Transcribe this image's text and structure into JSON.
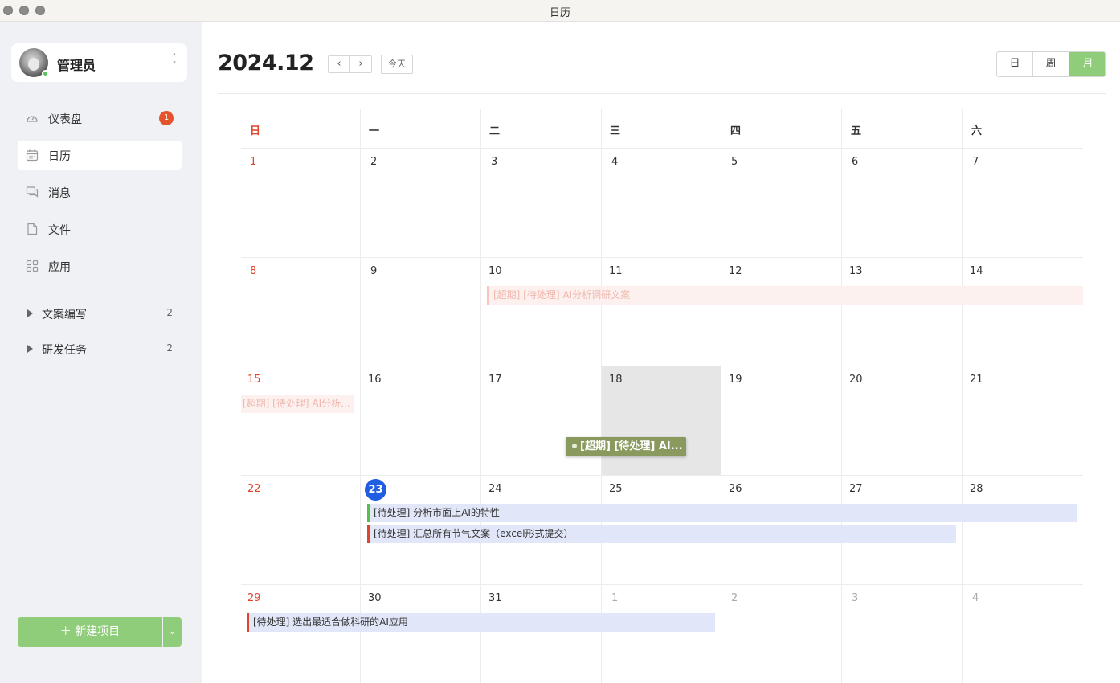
{
  "window": {
    "title": "日历"
  },
  "user": {
    "name": "管理员"
  },
  "nav": {
    "items": [
      {
        "label": "仪表盘",
        "badge": "1",
        "icon": "dashboard-icon"
      },
      {
        "label": "日历",
        "icon": "calendar-icon"
      },
      {
        "label": "消息",
        "icon": "message-icon"
      },
      {
        "label": "文件",
        "icon": "file-icon"
      },
      {
        "label": "应用",
        "icon": "apps-icon"
      }
    ]
  },
  "groups": [
    {
      "label": "文案编写",
      "count": "2"
    },
    {
      "label": "研发任务",
      "count": "2"
    }
  ],
  "new_button": {
    "label": "＋  新建项目"
  },
  "header": {
    "month": "2024.12",
    "prev": "‹",
    "next": "›",
    "today": "今天",
    "views": [
      "日",
      "周",
      "月"
    ],
    "active_view": "月"
  },
  "calendar": {
    "weekdays": [
      "日",
      "一",
      "二",
      "三",
      "四",
      "五",
      "六"
    ],
    "weeks": [
      [
        "1",
        "2",
        "3",
        "4",
        "5",
        "6",
        "7"
      ],
      [
        "8",
        "9",
        "10",
        "11",
        "12",
        "13",
        "14"
      ],
      [
        "15",
        "16",
        "17",
        "18",
        "19",
        "20",
        "21"
      ],
      [
        "22",
        "23",
        "24",
        "25",
        "26",
        "27",
        "28"
      ],
      [
        "29",
        "30",
        "31",
        "1",
        "2",
        "3",
        "4"
      ]
    ],
    "today": "23",
    "events": {
      "e1": "[超期] [待处理] AI分析调研文案",
      "e2": "[超期] [待处理] AI分析...",
      "e3": "[待处理] 分析市面上AI的特性",
      "e4": "[待处理] 汇总所有节气文案（excel形式提交）",
      "e5": "[待处理] 选出最适合做科研的AI应用",
      "drag": "[超期] [待处理] AI..."
    },
    "colors": {
      "accent": "#8fcd7a",
      "today": "#1f5ee0",
      "sunday": "#e0442b",
      "badge": "#e5532d"
    }
  }
}
